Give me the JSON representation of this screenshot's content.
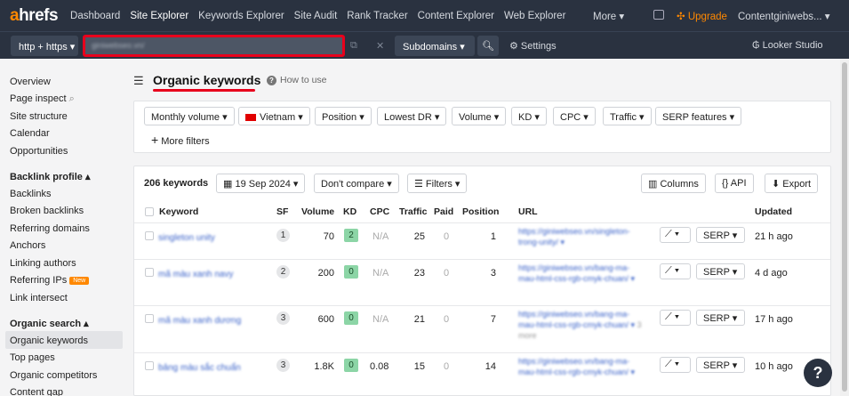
{
  "topnav": {
    "logo_a": "a",
    "logo_rest": "hrefs",
    "items": [
      "Dashboard",
      "Site Explorer",
      "Keywords Explorer",
      "Site Audit",
      "Rank Tracker",
      "Content Explorer",
      "Web Explorer"
    ],
    "more": "More ▾",
    "upgrade": "Upgrade",
    "account": "Contentginiwebs... ▾"
  },
  "searchbar": {
    "protocol": "http + https ▾",
    "url": "giniwebseo.vn/",
    "mode": "Subdomains ▾",
    "settings": "Settings",
    "looker": "Looker Studio"
  },
  "sidebar": {
    "items_top": [
      "Overview",
      "Page inspect",
      "Site structure",
      "Calendar",
      "Opportunities"
    ],
    "backlink_header": "Backlink profile ▴",
    "backlink_items": [
      "Backlinks",
      "Broken backlinks",
      "Referring domains",
      "Anchors",
      "Linking authors",
      "Referring IPs",
      "Link intersect"
    ],
    "new_badge": "New",
    "organic_header": "Organic search ▴",
    "organic_items": [
      "Organic keywords",
      "Top pages",
      "Organic competitors",
      "Content gap"
    ]
  },
  "header": {
    "title": "Organic keywords",
    "how_to": "How to use"
  },
  "filters": {
    "items": [
      "Monthly volume ▾",
      "Vietnam ▾",
      "Position ▾",
      "Lowest DR ▾",
      "Volume ▾",
      "KD ▾",
      "CPC ▾",
      "Traffic ▾",
      "SERP features ▾"
    ],
    "more": "More filters"
  },
  "toolbar": {
    "count": "206 keywords",
    "date": "19 Sep 2024 ▾",
    "compare": "Don't compare ▾",
    "filters": "Filters ▾",
    "columns": "Columns",
    "api": "API",
    "export": "Export"
  },
  "table": {
    "headers": [
      "Keyword",
      "SF",
      "Volume",
      "KD",
      "CPC",
      "Traffic",
      "Paid",
      "Position",
      "URL",
      "Updated"
    ],
    "rows": [
      {
        "keyword": "singleton unity",
        "sf": "1",
        "volume": "70",
        "kd": "2",
        "cpc": "N/A",
        "traffic": "25",
        "paid": "0",
        "position": "1",
        "url": "https://giniwebseo.vn/singleton-trong-unity/ ▾",
        "more": "",
        "serp": "SERP ▾",
        "updated": "21 h ago"
      },
      {
        "keyword": "mã màu xanh navy",
        "sf": "2",
        "volume": "200",
        "kd": "0",
        "cpc": "N/A",
        "traffic": "23",
        "paid": "0",
        "position": "3",
        "url": "https://giniwebseo.vn/bang-ma-mau-html-css-rgb-cmyk-chuan/ ▾",
        "more": "",
        "serp": "SERP ▾",
        "updated": "4 d ago"
      },
      {
        "keyword": "mã màu xanh dương",
        "sf": "3",
        "volume": "600",
        "kd": "0",
        "cpc": "N/A",
        "traffic": "21",
        "paid": "0",
        "position": "7",
        "url": "https://giniwebseo.vn/bang-ma-mau-html-css-rgb-cmyk-chuan/ ▾",
        "more": "3 more",
        "serp": "SERP ▾",
        "updated": "17 h ago"
      },
      {
        "keyword": "bảng màu sắc chuẩn",
        "sf": "3",
        "volume": "1.8K",
        "kd": "0",
        "cpc": "0.08",
        "traffic": "15",
        "paid": "0",
        "position": "14",
        "url": "https://giniwebseo.vn/bang-ma-mau-html-css-rgb-cmyk-chuan/ ▾",
        "more": "",
        "serp": "SERP ▾",
        "updated": "10 h ago"
      }
    ]
  },
  "help": "?"
}
